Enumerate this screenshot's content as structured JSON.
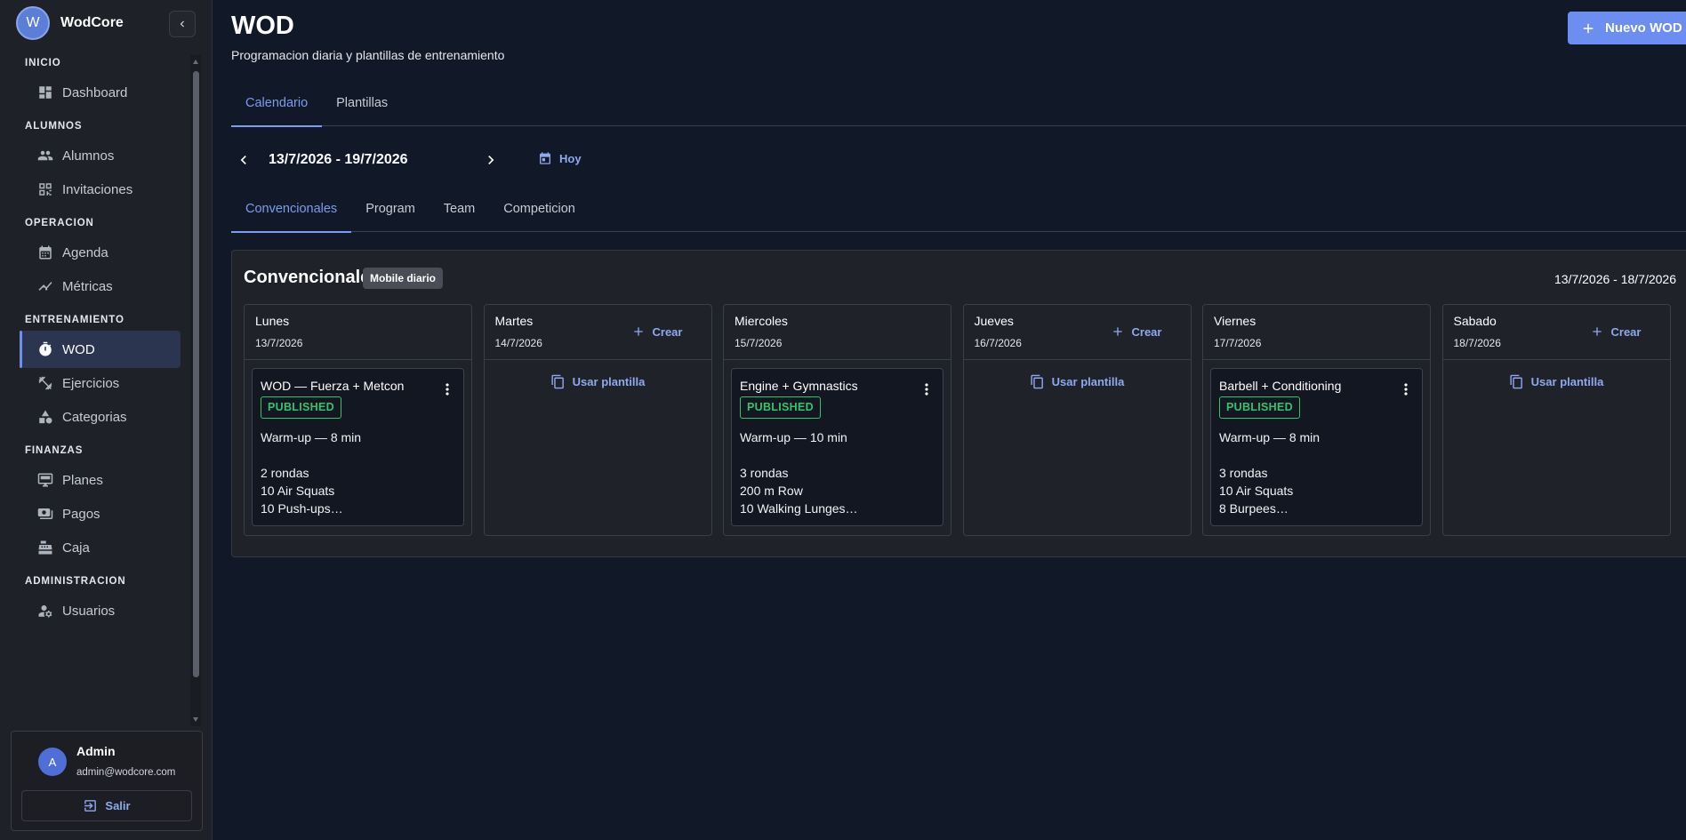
{
  "brand": {
    "initial": "W",
    "name": "WodCore"
  },
  "nav": {
    "sections": [
      {
        "title": "INICIO",
        "items": [
          {
            "label": "Dashboard",
            "icon": "dashboard-icon"
          }
        ]
      },
      {
        "title": "ALUMNOS",
        "items": [
          {
            "label": "Alumnos",
            "icon": "people-icon"
          },
          {
            "label": "Invitaciones",
            "icon": "qr-code-icon"
          }
        ]
      },
      {
        "title": "OPERACION",
        "items": [
          {
            "label": "Agenda",
            "icon": "calendar-icon"
          },
          {
            "label": "Métricas",
            "icon": "chart-line-icon"
          }
        ]
      },
      {
        "title": "ENTRENAMIENTO",
        "items": [
          {
            "label": "WOD",
            "icon": "timer-icon",
            "active": true
          },
          {
            "label": "Ejercicios",
            "icon": "fitness-icon"
          },
          {
            "label": "Categorias",
            "icon": "shapes-icon"
          }
        ]
      },
      {
        "title": "FINANZAS",
        "items": [
          {
            "label": "Planes",
            "icon": "monitor-icon"
          },
          {
            "label": "Pagos",
            "icon": "payments-icon"
          },
          {
            "label": "Caja",
            "icon": "cash-register-icon"
          }
        ]
      },
      {
        "title": "ADMINISTRACION",
        "items": [
          {
            "label": "Usuarios",
            "icon": "user-settings-icon"
          }
        ]
      }
    ]
  },
  "user": {
    "initial": "A",
    "name": "Admin",
    "email": "admin@wodcore.com",
    "logout_label": "Salir"
  },
  "header": {
    "title": "WOD",
    "subtitle": "Programacion diaria y plantillas de entrenamiento",
    "new_button": "Nuevo WOD"
  },
  "primary_tabs": [
    {
      "label": "Calendario",
      "active": true
    },
    {
      "label": "Plantillas",
      "active": false
    }
  ],
  "week": {
    "range": "13/7/2026 - 19/7/2026",
    "today_label": "Hoy"
  },
  "secondary_tabs": [
    {
      "label": "Convencionales",
      "active": true
    },
    {
      "label": "Program",
      "active": false
    },
    {
      "label": "Team",
      "active": false
    },
    {
      "label": "Competicion",
      "active": false
    }
  ],
  "panel": {
    "title": "Convencionales",
    "badge": "Mobile diario",
    "range": "13/7/2026 - 18/7/2026"
  },
  "labels": {
    "create": "Crear",
    "use_template": "Usar plantilla"
  },
  "days": [
    {
      "name": "Lunes",
      "date": "13/7/2026",
      "wod": {
        "title": "WOD — Fuerza + Metcon",
        "status": "PUBLISHED",
        "lines": [
          "Warm-up — 8 min",
          "",
          "2 rondas",
          "10 Air Squats",
          "10 Push-ups…"
        ]
      }
    },
    {
      "name": "Martes",
      "date": "14/7/2026",
      "wod": null
    },
    {
      "name": "Miercoles",
      "date": "15/7/2026",
      "wod": {
        "title": "Engine + Gymnastics",
        "status": "PUBLISHED",
        "lines": [
          "Warm-up — 10 min",
          "",
          "3 rondas",
          "200 m Row",
          "10 Walking Lunges…"
        ]
      }
    },
    {
      "name": "Jueves",
      "date": "16/7/2026",
      "wod": null
    },
    {
      "name": "Viernes",
      "date": "17/7/2026",
      "wod": {
        "title": "Barbell + Conditioning",
        "status": "PUBLISHED",
        "lines": [
          "Warm-up — 8 min",
          "",
          "3 rondas",
          "10 Air Squats",
          "8 Burpees…"
        ]
      }
    },
    {
      "name": "Sabado",
      "date": "18/7/2026",
      "wod": null
    }
  ]
}
